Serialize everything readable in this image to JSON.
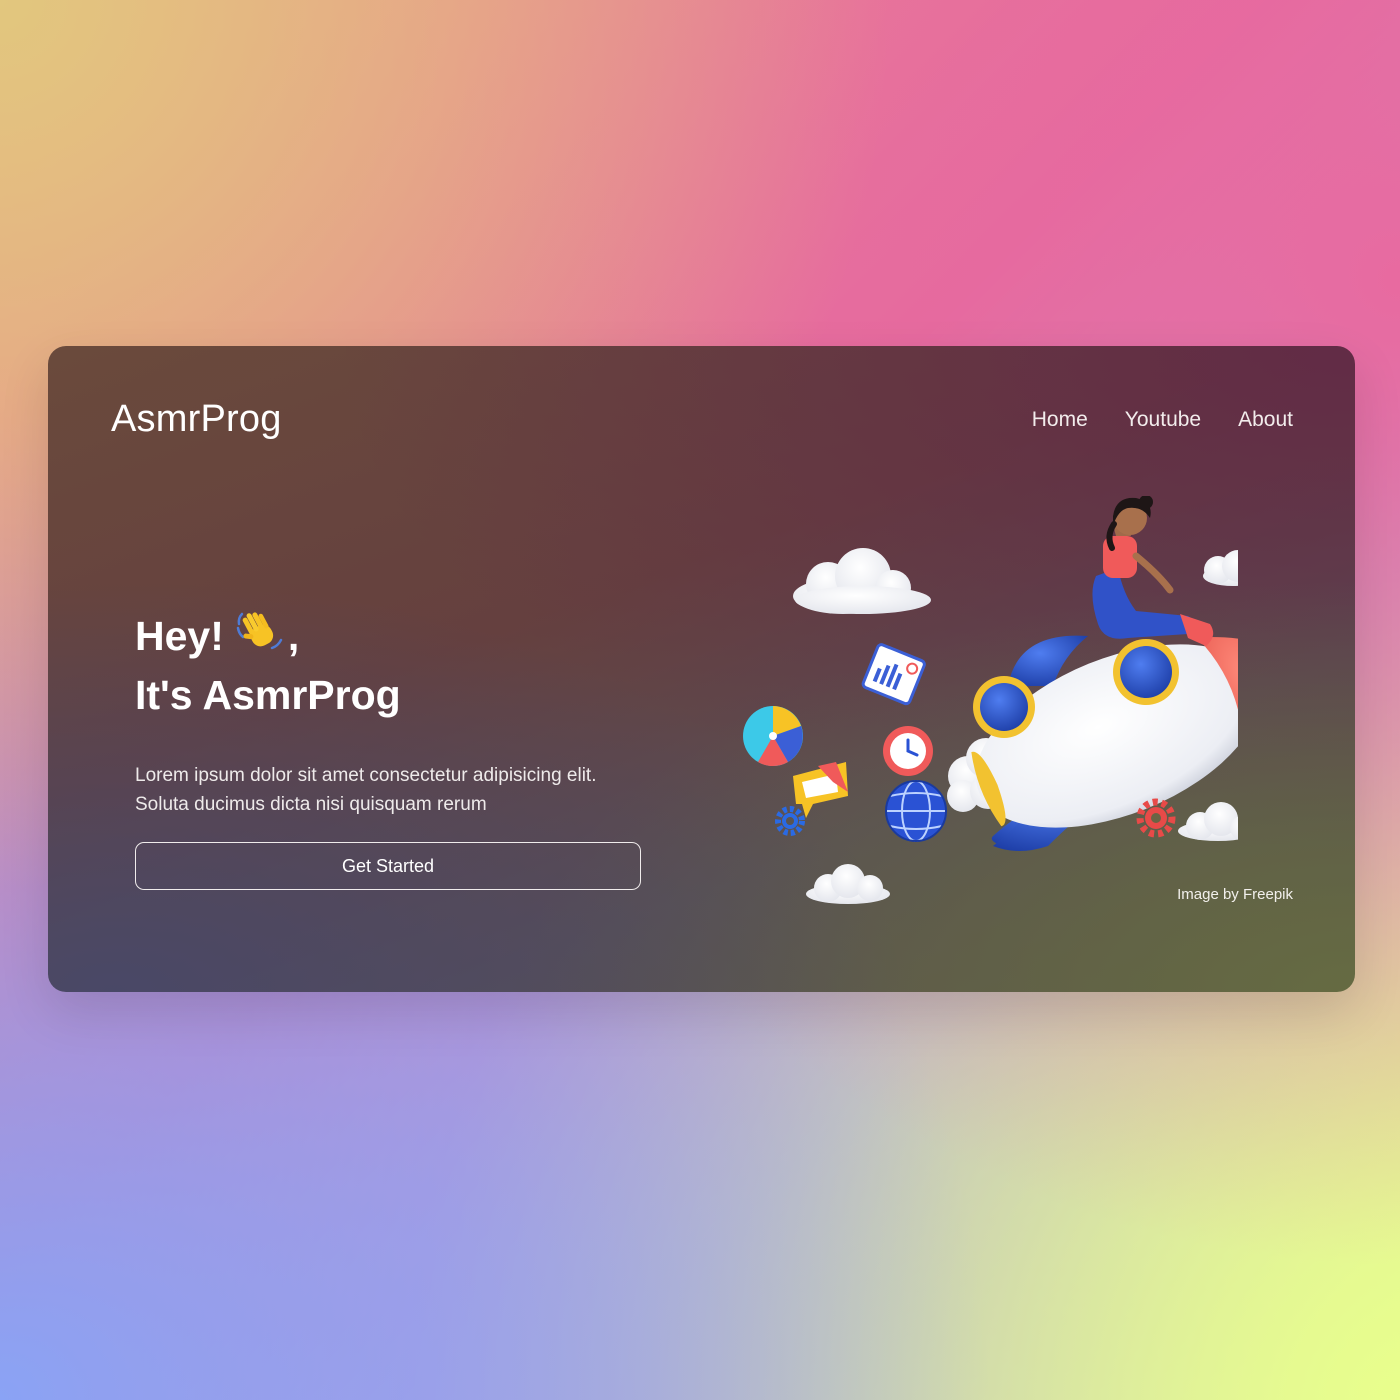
{
  "brand": {
    "logo_text": "AsmrProg"
  },
  "nav": {
    "items": [
      {
        "label": "Home"
      },
      {
        "label": "Youtube"
      },
      {
        "label": "About"
      }
    ]
  },
  "hero": {
    "greeting": "Hey!",
    "greeting_suffix": ",",
    "wave_icon": "waving-hand-icon",
    "title": "It's AsmrProg",
    "description_line1": "Lorem ipsum dolor sit amet consectetur adipisicing elit.",
    "description_line2": "Soluta ducimus dicta nisi quisquam rerum",
    "cta_label": "Get Started"
  },
  "illustration": {
    "subject": "girl-on-rocket-illustration",
    "credit": "Image by Freepik"
  },
  "colors": {
    "rocket_blue": "#2a52d4",
    "rocket_red": "#f26b5e",
    "rocket_rim": "#f2c230"
  }
}
